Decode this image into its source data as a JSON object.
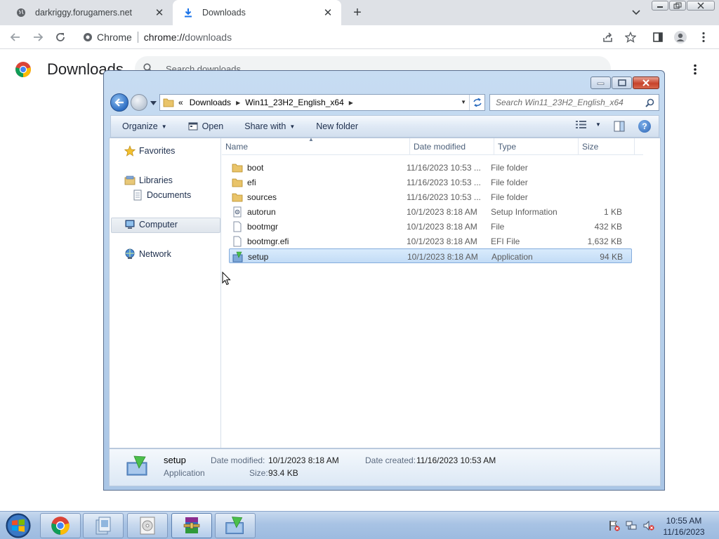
{
  "browser": {
    "tabs": [
      {
        "title": "darkriggy.forugamers.net",
        "icon": "globe-icon",
        "active": false
      },
      {
        "title": "Downloads",
        "icon": "download-icon",
        "active": true
      }
    ],
    "omnibox": {
      "site_label": "Chrome",
      "url_host": "chrome://",
      "url_path": "downloads"
    }
  },
  "downloads_page": {
    "title": "Downloads",
    "search_placeholder": "Search downloads"
  },
  "explorer": {
    "breadcrumb": {
      "prefix": "«",
      "items": [
        "Downloads",
        "Win11_23H2_English_x64"
      ]
    },
    "search_placeholder": "Search Win11_23H2_English_x64",
    "commands": {
      "organize": "Organize",
      "open": "Open",
      "share_with": "Share with",
      "new_folder": "New folder"
    },
    "nav": {
      "favorites": "Favorites",
      "libraries": "Libraries",
      "documents": "Documents",
      "computer": "Computer",
      "network": "Network"
    },
    "columns": {
      "name": "Name",
      "date_modified": "Date modified",
      "type": "Type",
      "size": "Size"
    },
    "files": [
      {
        "name": "boot",
        "date": "11/16/2023 10:53 ...",
        "type": "File folder",
        "size": "",
        "icon": "folder-icon",
        "selected": false
      },
      {
        "name": "efi",
        "date": "11/16/2023 10:53 ...",
        "type": "File folder",
        "size": "",
        "icon": "folder-icon",
        "selected": false
      },
      {
        "name": "sources",
        "date": "11/16/2023 10:53 ...",
        "type": "File folder",
        "size": "",
        "icon": "folder-icon",
        "selected": false
      },
      {
        "name": "autorun",
        "date": "10/1/2023 8:18 AM",
        "type": "Setup Information",
        "size": "1 KB",
        "icon": "settings-file-icon",
        "selected": false
      },
      {
        "name": "bootmgr",
        "date": "10/1/2023 8:18 AM",
        "type": "File",
        "size": "432 KB",
        "icon": "file-icon",
        "selected": false
      },
      {
        "name": "bootmgr.efi",
        "date": "10/1/2023 8:18 AM",
        "type": "EFI File",
        "size": "1,632 KB",
        "icon": "file-icon",
        "selected": false
      },
      {
        "name": "setup",
        "date": "10/1/2023 8:18 AM",
        "type": "Application",
        "size": "94 KB",
        "icon": "setup-app-icon",
        "selected": true
      }
    ],
    "details": {
      "name": "setup",
      "type": "Application",
      "date_modified_label": "Date modified:",
      "date_modified": "10/1/2023 8:18 AM",
      "date_created_label": "Date created:",
      "date_created": "11/16/2023 10:53 AM",
      "size_label": "Size:",
      "size": "93.4 KB"
    }
  },
  "taskbar": {
    "time": "10:55 AM",
    "date": "11/16/2023"
  }
}
